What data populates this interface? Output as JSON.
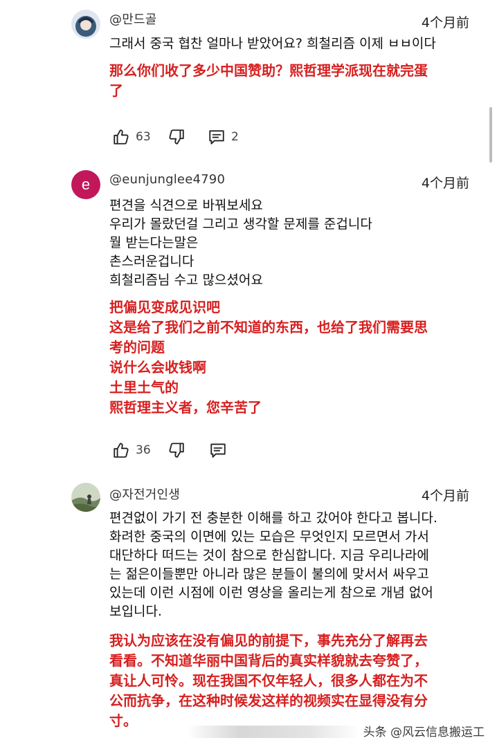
{
  "comments": [
    {
      "handle": "@만드골",
      "time": "4个月前",
      "lines": [
        "그래서 중국 협찬 얼마나 받았어요? 희철리즘 이제 ㅂㅂ이다"
      ],
      "translation": [
        "那么你们收了多少中国赞助？熙哲理学派现在就完蛋",
        "了"
      ],
      "likes": "63",
      "replies": "2",
      "avatar_color": "#4a6a8a"
    },
    {
      "handle": "@eunjunglee4790",
      "time": "4个月前",
      "lines": [
        "편견을 식견으로 바꿔보세요",
        "우리가 몰랐던걸 그리고 생각할 문제를 준겁니다",
        "뭘 받는다는말은",
        "촌스러운겁니다",
        "희철리즘님 수고 많으셨어요"
      ],
      "translation": [
        "把偏见变成见识吧",
        "这是给了我们之前不知道的东西，也给了我们需要思",
        "考的问题",
        "说什么会收钱啊",
        "土里土气的",
        "熙哲理主义者，您辛苦了"
      ],
      "likes": "36",
      "replies": "",
      "avatar_letter": "e",
      "avatar_color": "#c2185b"
    },
    {
      "handle": "@자전거인생",
      "time": "4个月前",
      "lines": [
        "편견없이 가기 전 충분한 이해를 하고 갔어야 한다고 봅니다.",
        "화려한 중국의 이면에 있는 모습은 무엇인지 모르면서 가서",
        "대단하다 떠드는 것이 참으로 한심합니다. 지금 우리나라에",
        "는 젊은이들뿐만 아니라 많은 분들이 불의에 맞서서 싸우고",
        "있는데 이런 시점에 이런 영상을 올리는게 참으로 개념 없어",
        "보입니다."
      ],
      "translation": [
        "我认为应该在没有偏见的前提下，事先充分了解再去",
        "看看。不知道华丽中国背后的真实样貌就去夸赞了，",
        "真让人可怜。现在我国不仅年轻人，很多人都在为不",
        "公而抗争，在这种时候发这样的视频实在显得没有分",
        "寸。"
      ],
      "avatar_color": "#7a8a6a"
    }
  ],
  "watermark": "头条 @风云信息搬运工"
}
